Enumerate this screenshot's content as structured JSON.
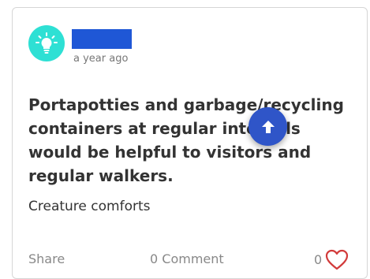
{
  "post": {
    "author_avatar_icon": "lightbulb-icon",
    "timestamp": "a year ago",
    "title": "Portapotties and garbage/recycling containers at regular intervals would be helpful to visitors and regular walkers.",
    "category": "Creature comforts"
  },
  "actions": {
    "share_label": "Share",
    "comment_label": "0 Comment",
    "like_count": "0",
    "like_icon": "heart-outline-icon"
  },
  "overlay": {
    "scroll_top_icon": "arrow-up-icon"
  },
  "colors": {
    "avatar_bg": "#2ee0d4",
    "author_redaction": "#1f57d6",
    "scroll_button": "#2f55c8",
    "heart": "#d23b3b"
  }
}
